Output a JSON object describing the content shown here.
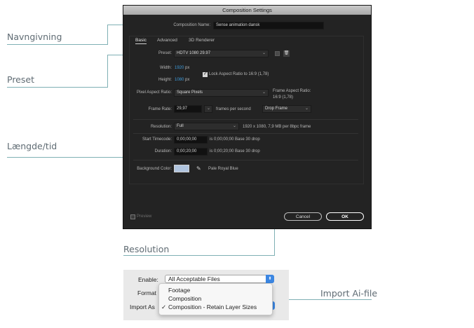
{
  "callouts": {
    "naming": "Navngivning",
    "preset": "Preset",
    "duration": "Længde/tid",
    "resolution": "Resolution",
    "import": "Import Ai-file"
  },
  "dialog": {
    "title": "Composition Settings",
    "comp_name_label": "Composition Name:",
    "comp_name_value": "Sense animation dansk",
    "tabs": [
      "Basic",
      "Advanced",
      "3D Renderer"
    ],
    "active_tab": "Basic",
    "preset_label": "Preset:",
    "preset_value": "HDTV 1080 29.97",
    "width_label": "Width:",
    "width_value": "1920",
    "width_unit": "px",
    "height_label": "Height:",
    "height_value": "1080",
    "height_unit": "px",
    "lock_aspect_label": "Lock Aspect Ratio to 16:9 (1,78)",
    "lock_aspect_checked": true,
    "pixel_aspect_label": "Pixel Aspect Ratio:",
    "pixel_aspect_value": "Square Pixels",
    "frame_aspect_label": "Frame Aspect Ratio:",
    "frame_aspect_value": "16:9 (1,78)",
    "frame_rate_label": "Frame Rate:",
    "frame_rate_value": "29,97",
    "frame_rate_unit": "frames per second",
    "drop_frame_value": "Drop Frame",
    "resolution_label": "Resolution:",
    "resolution_value": "Full",
    "resolution_info": "1920 x 1080, 7,9 MB per 8bpc frame",
    "start_tc_label": "Start Timecode:",
    "start_tc_value": "0;00;00;00",
    "start_tc_info": "is 0;00;00;00  Base 30  drop",
    "duration_label": "Duration:",
    "duration_value": "0;00;20;00",
    "duration_info": "is 0;00;20;00  Base 30  drop",
    "bg_color_label": "Background Color:",
    "bg_color_name": "Pale Royal Blue",
    "bg_color_hex": "#b0c4de",
    "preview_label": "Preview",
    "cancel_label": "Cancel",
    "ok_label": "OK"
  },
  "import_panel": {
    "enable_label": "Enable:",
    "enable_value": "All Acceptable Files",
    "format_label": "Format",
    "import_as_label": "Import As",
    "menu_items": [
      "Footage",
      "Composition",
      "Composition - Retain Layer Sizes"
    ],
    "selected_item_index": 2,
    "checkmark": "✓"
  },
  "colors": {
    "callout_line": "#7fb0b4",
    "dialog_bg": "#232323",
    "accent_blue": "#3e9bdb",
    "mac_blue": "#3b86e2"
  }
}
